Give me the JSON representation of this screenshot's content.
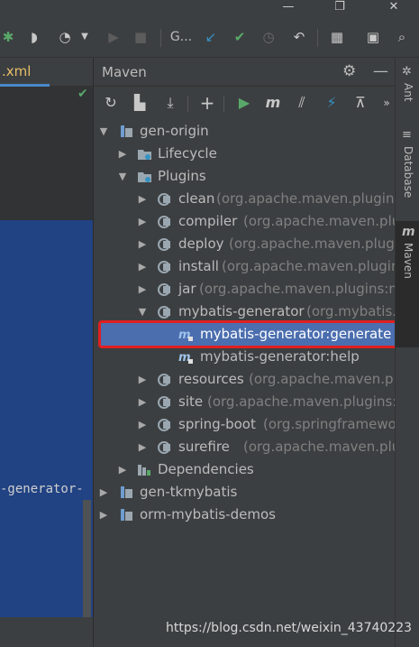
{
  "editor": {
    "tab_label": ".xml",
    "code_fragment": "-generator-"
  },
  "toolbar": {
    "run_config_label": "G..."
  },
  "maven_panel": {
    "title": "Maven",
    "tree": [
      {
        "label": "gen-origin",
        "detail": ""
      },
      {
        "label": "Lifecycle",
        "detail": ""
      },
      {
        "label": "Plugins",
        "detail": ""
      },
      {
        "label": "clean",
        "detail": "(org.apache.maven.plugins:"
      },
      {
        "label": "compiler",
        "detail": "(org.apache.maven.plug"
      },
      {
        "label": "deploy",
        "detail": "(org.apache.maven.plugin"
      },
      {
        "label": "install",
        "detail": "(org.apache.maven.plugins"
      },
      {
        "label": "jar",
        "detail": "(org.apache.maven.plugins:ma"
      },
      {
        "label": "mybatis-generator",
        "detail": "(org.mybatis.c"
      },
      {
        "label": "mybatis-generator:generate",
        "detail": ""
      },
      {
        "label": "mybatis-generator:help",
        "detail": ""
      },
      {
        "label": "resources",
        "detail": "(org.apache.maven.plu"
      },
      {
        "label": "site",
        "detail": "(org.apache.maven.plugins:m"
      },
      {
        "label": "spring-boot",
        "detail": "(org.springframewor"
      },
      {
        "label": "surefire",
        "detail": "(org.apache.maven.plugi"
      },
      {
        "label": "Dependencies",
        "detail": ""
      },
      {
        "label": "gen-tkmybatis",
        "detail": ""
      },
      {
        "label": "orm-mybatis-demos",
        "detail": ""
      }
    ]
  },
  "side_tabs": {
    "ant": "Ant",
    "database": "Database",
    "maven": "Maven"
  },
  "watermark": "https://blog.csdn.net/weixin_43740223",
  "colors": {
    "selection": "#4b6eaf",
    "highlight_box": "#e02020",
    "run_green": "#59a869"
  }
}
